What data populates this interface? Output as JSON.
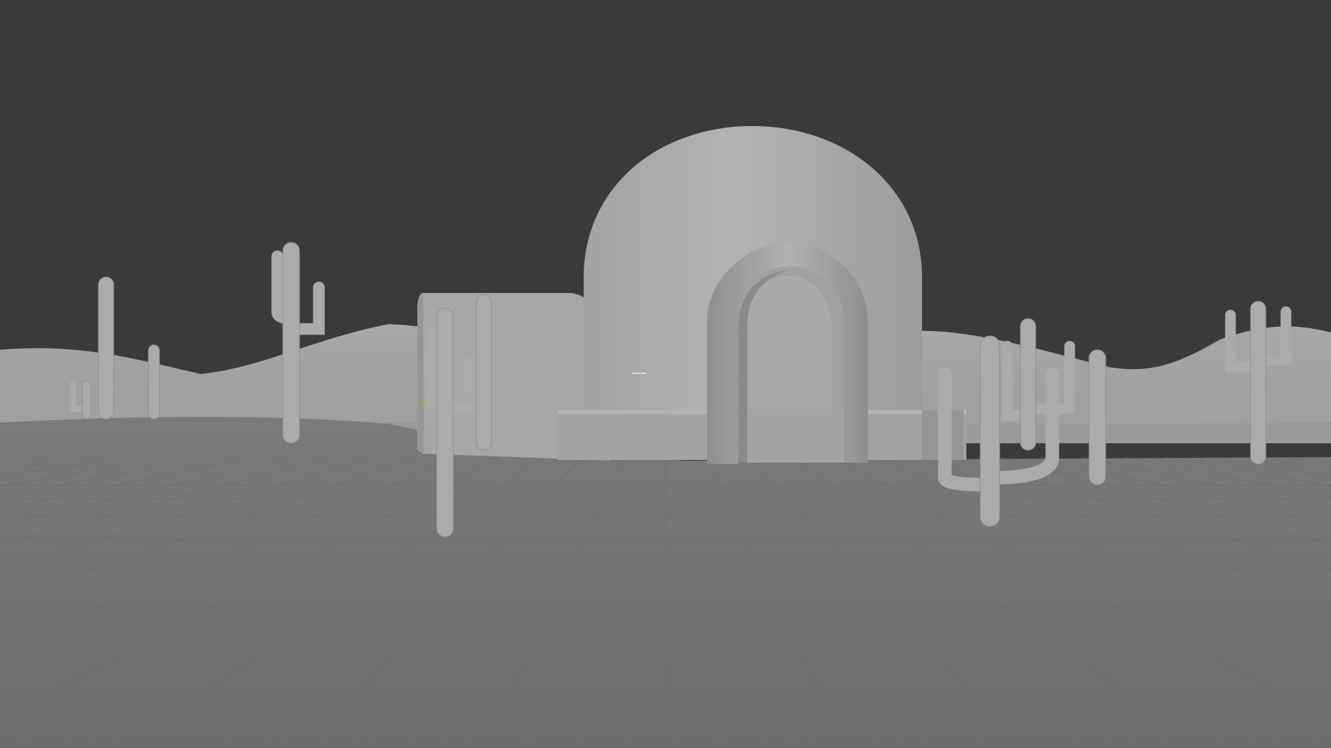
{
  "viewport": {
    "mode": "solid-shading",
    "background": "#3a3a3a",
    "ground_color": "#717171",
    "object_color": "#a9a9a9",
    "object_color_dark": "#8c8c8c",
    "grid_line_color": "#686868",
    "origin_marker_color": "#e09a1f"
  },
  "scene": {
    "objects": [
      {
        "name": "dome",
        "icon": "dome-shape"
      },
      {
        "name": "arch-entrance",
        "icon": "arch-shape"
      },
      {
        "name": "side-wing",
        "icon": "box-shape"
      },
      {
        "name": "cacti",
        "icon": "cactus-shape"
      },
      {
        "name": "dunes",
        "icon": "terrain-shape"
      }
    ]
  }
}
